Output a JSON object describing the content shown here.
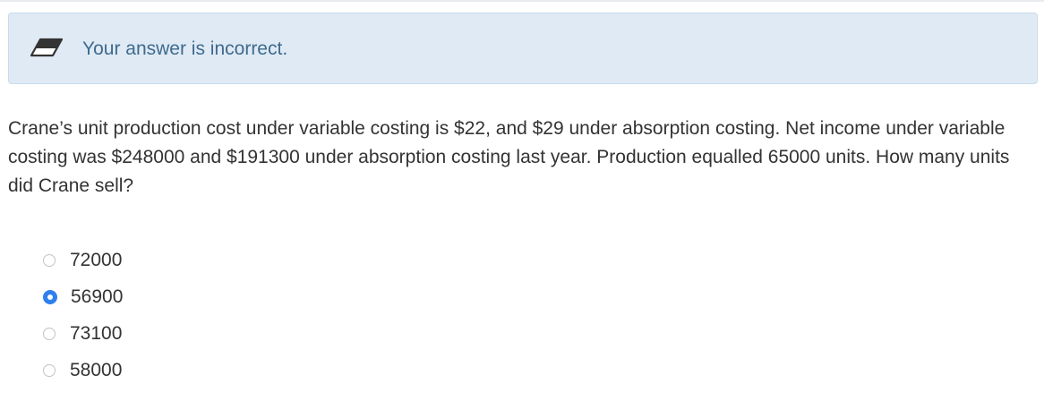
{
  "feedback": {
    "message": "Your answer is incorrect.",
    "icon": "eraser-icon",
    "background_color": "#dfeaf4",
    "text_color": "#3f6a8e"
  },
  "question": {
    "text": "Crane’s unit production cost under variable costing is $22, and $29 under absorption costing. Net income under variable costing was $248000 and $191300 under absorption costing last year. Production equalled 65000 units. How many units did Crane sell?"
  },
  "options": [
    {
      "label": "72000",
      "selected": false
    },
    {
      "label": "56900",
      "selected": true
    },
    {
      "label": "73100",
      "selected": false
    },
    {
      "label": "58000",
      "selected": false
    }
  ],
  "accent_color": "#2f80ed"
}
